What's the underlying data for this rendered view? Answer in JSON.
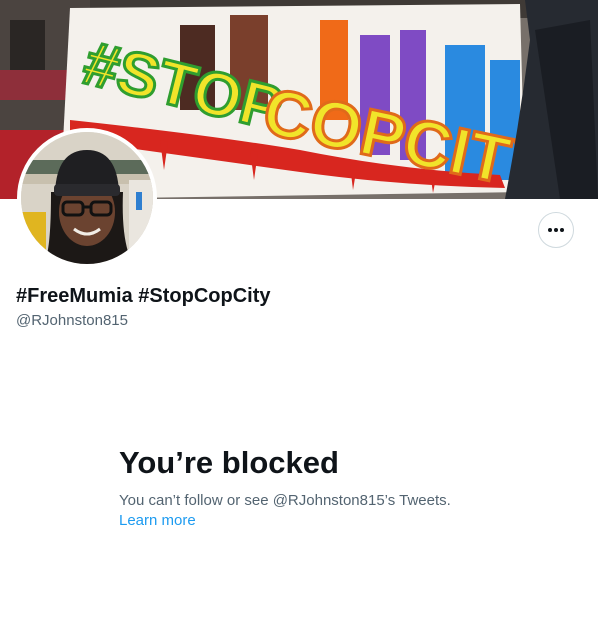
{
  "profile": {
    "display_name": "#FreeMumia #StopCopCity",
    "handle": "@RJohnston815"
  },
  "banner": {
    "sign_text": "#STOPCOPCITY",
    "subject": "protest-banner-photo"
  },
  "avatar": {
    "subject": "profile-photo"
  },
  "actions": {
    "more_icon": "more-horizontal-icon"
  },
  "blocked": {
    "title": "You’re blocked",
    "message": "You can’t follow or see @RJohnston815’s Tweets.",
    "learn_more": "Learn more"
  },
  "colors": {
    "text_primary": "#0f1419",
    "text_secondary": "#536471",
    "link": "#1d9bf0",
    "border": "#cfd9de"
  }
}
